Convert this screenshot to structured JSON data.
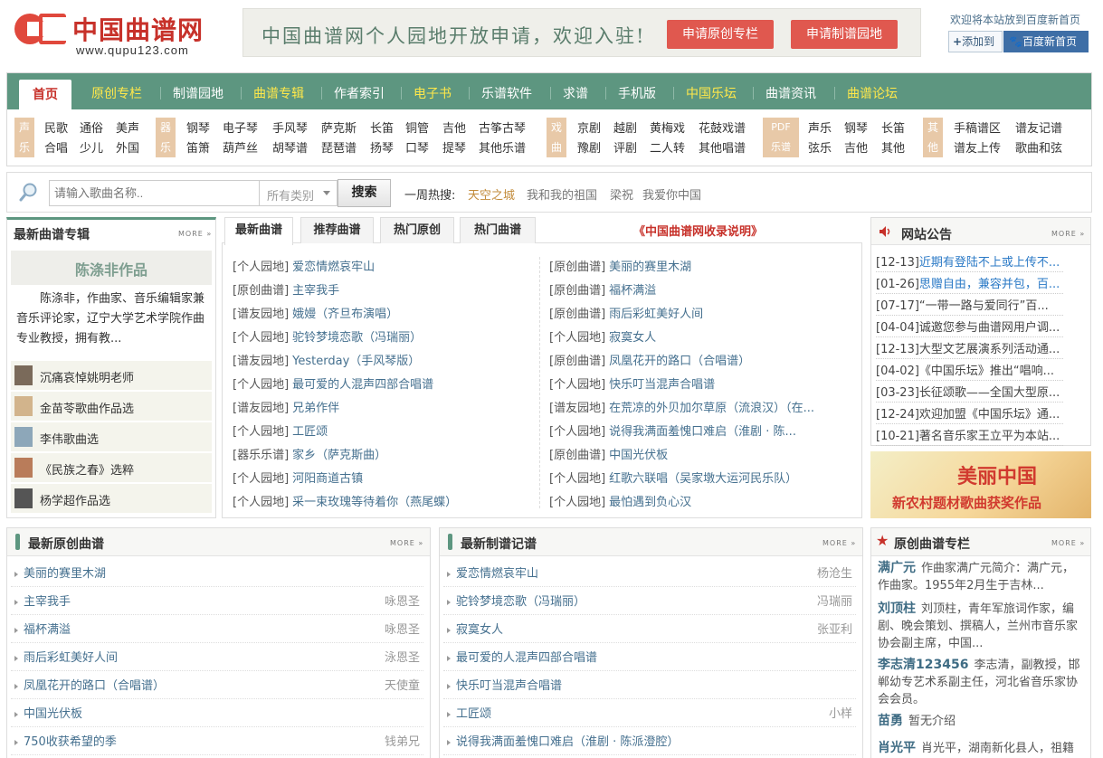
{
  "header": {
    "logo_text": "中国曲谱网",
    "logo_sub": "www.qupu123.com",
    "banner_text": "中国曲谱网个人园地开放申请，欢迎入驻!",
    "apply_original": "申请原创专栏",
    "apply_garden": "申请制谱园地",
    "welcome": "欢迎将本站放到百度新首页",
    "add_to": "添加到",
    "baidu_home": "百度新首页"
  },
  "nav": {
    "items": [
      {
        "label": "首页",
        "highlight": false
      },
      {
        "label": "原创专栏",
        "highlight": true
      },
      {
        "label": "制谱园地",
        "highlight": false
      },
      {
        "label": "曲谱专辑",
        "highlight": true
      },
      {
        "label": "作者索引",
        "highlight": false
      },
      {
        "label": "电子书",
        "highlight": true
      },
      {
        "label": "乐谱软件",
        "highlight": false
      },
      {
        "label": "求谱",
        "highlight": false
      },
      {
        "label": "手机版",
        "highlight": false
      },
      {
        "label": "中国乐坛",
        "highlight": true
      },
      {
        "label": "曲谱资讯",
        "highlight": false
      },
      {
        "label": "曲谱论坛",
        "highlight": true
      }
    ],
    "categories": [
      {
        "badge": [
          "声",
          "乐"
        ],
        "links": [
          "民歌",
          "通俗",
          "美声",
          "合唱",
          "少儿",
          "外国"
        ]
      },
      {
        "badge": [
          "器",
          "乐"
        ],
        "links": [
          "钢琴",
          "电子琴",
          "手风琴",
          "萨克斯",
          "长笛",
          "铜管",
          "吉他",
          "古筝古琴",
          "笛箫",
          "葫芦丝",
          "胡琴谱",
          "琵琶谱",
          "扬琴",
          "口琴",
          "提琴",
          "其他乐谱"
        ]
      },
      {
        "badge": [
          "戏",
          "曲"
        ],
        "links": [
          "京剧",
          "越剧",
          "黄梅戏",
          "花鼓戏谱",
          "豫剧",
          "评剧",
          "二人转",
          "其他唱谱"
        ]
      },
      {
        "badge": [
          "PDF",
          "乐谱"
        ],
        "links": [
          "声乐",
          "钢琴",
          "长笛",
          "弦乐",
          "吉他",
          "其他"
        ]
      },
      {
        "badge": [
          "其",
          "他"
        ],
        "links": [
          "手稿谱区",
          "谱友记谱",
          "谱友上传",
          "歌曲和弦"
        ]
      }
    ]
  },
  "search": {
    "placeholder": "请输入歌曲名称..",
    "category": "所有类别",
    "button": "搜索",
    "hot_label": "一周热搜:",
    "hot": [
      "天空之城",
      "我和我的祖国",
      "梁祝",
      "我爱你中国"
    ]
  },
  "albums": {
    "title": "最新曲谱专辑",
    "more": "MORE »",
    "featured_title": "陈涤非作品",
    "featured_desc": "陈涤非，作曲家、音乐编辑家兼音乐评论家，辽宁大学艺术学院作曲专业教授，拥有教...",
    "items": [
      "沉痛哀悼姚明老师",
      "金苗苓歌曲作品选",
      "李伟歌曲选",
      "《民族之春》选粹",
      "杨学超作品选"
    ]
  },
  "tabs": {
    "items": [
      "最新曲谱",
      "推荐曲谱",
      "热门原创",
      "热门曲谱"
    ],
    "notice_link": "《中国曲谱网收录说明》",
    "left": [
      {
        "tag": "[个人园地]",
        "title": "爱恋情燃哀牢山"
      },
      {
        "tag": "[原创曲谱]",
        "title": "主宰我手"
      },
      {
        "tag": "[谱友园地]",
        "title": "娥嫚（齐旦布演唱）"
      },
      {
        "tag": "[个人园地]",
        "title": "驼铃梦境恋歌（冯瑞丽）"
      },
      {
        "tag": "[谱友园地]",
        "title": "Yesterday（手风琴版）"
      },
      {
        "tag": "[个人园地]",
        "title": "最可爱的人混声四部合唱谱"
      },
      {
        "tag": "[谱友园地]",
        "title": "兄弟作伴"
      },
      {
        "tag": "[个人园地]",
        "title": "工匠颂"
      },
      {
        "tag": "[器乐乐谱]",
        "title": "家乡（萨克斯曲）"
      },
      {
        "tag": "[个人园地]",
        "title": "河阳商道古镇"
      },
      {
        "tag": "[个人园地]",
        "title": "采一束玫瑰等待着你（燕尾蝶）"
      }
    ],
    "right": [
      {
        "tag": "[原创曲谱]",
        "title": "美丽的赛里木湖"
      },
      {
        "tag": "[原创曲谱]",
        "title": "福杯满溢"
      },
      {
        "tag": "[原创曲谱]",
        "title": "雨后彩虹美好人间"
      },
      {
        "tag": "[个人园地]",
        "title": "寂寞女人"
      },
      {
        "tag": "[原创曲谱]",
        "title": "凤凰花开的路口（合唱谱）"
      },
      {
        "tag": "[个人园地]",
        "title": "快乐叮当混声合唱谱"
      },
      {
        "tag": "[谱友园地]",
        "title": "在荒凉的外贝加尔草原（流浪汉）（在..."
      },
      {
        "tag": "[个人园地]",
        "title": "说得我满面羞愧口难启（淮剧 · 陈..."
      },
      {
        "tag": "[原创曲谱]",
        "title": "中国光伏板"
      },
      {
        "tag": "[个人园地]",
        "title": "红歌六联唱（吴家墩大运河民乐队）"
      },
      {
        "tag": "[个人园地]",
        "title": "最怕遇到负心汉"
      }
    ]
  },
  "notices": {
    "title": "网站公告",
    "more": "MORE »",
    "items": [
      {
        "date": "[12-13]",
        "text": "近期有登陆不上或上传不...",
        "link": true
      },
      {
        "date": "[01-26]",
        "text": "思赠自由，兼容并包，百...",
        "link": true
      },
      {
        "date": "[07-17]",
        "text": "“一带一路与爱同行”百...",
        "link": false
      },
      {
        "date": "[04-04]",
        "text": "诚邀您参与曲谱网用户调...",
        "link": false
      },
      {
        "date": "[12-13]",
        "text": "大型文艺展演系列活动通...",
        "link": false
      },
      {
        "date": "[04-02]",
        "text": "《中国乐坛》推出“唱响...",
        "link": false
      },
      {
        "date": "[03-23]",
        "text": "长征颂歌——全国大型原...",
        "link": false
      },
      {
        "date": "[12-24]",
        "text": "欢迎加盟《中国乐坛》通...",
        "link": false
      },
      {
        "date": "[10-21]",
        "text": "著名音乐家王立平为本站...",
        "link": false
      }
    ],
    "ad_title": "美丽中国",
    "ad_sub": "新农村题材歌曲获奖作品"
  },
  "original": {
    "title": "最新原创曲谱",
    "more": "MORE »",
    "rows": [
      {
        "title": "美丽的赛里木湖",
        "author": ""
      },
      {
        "title": "主宰我手",
        "author": "咏恩圣"
      },
      {
        "title": "福杯满溢",
        "author": "咏恩圣"
      },
      {
        "title": "雨后彩虹美好人间",
        "author": "泳恩圣"
      },
      {
        "title": "凤凰花开的路口（合唱谱）",
        "author": "天使童"
      },
      {
        "title": "中国光伏板",
        "author": ""
      },
      {
        "title": "750收获希望的季",
        "author": "钱弟兄"
      }
    ]
  },
  "scored": {
    "title": "最新制谱记谱",
    "more": "MORE »",
    "rows": [
      {
        "title": "爱恋情燃哀牢山",
        "author": "杨沧生"
      },
      {
        "title": "驼铃梦境恋歌（冯瑞丽）",
        "author": "冯瑞丽"
      },
      {
        "title": "寂寞女人",
        "author": "张亚利"
      },
      {
        "title": "最可爱的人混声四部合唱谱",
        "author": ""
      },
      {
        "title": "快乐叮当混声合唱谱",
        "author": ""
      },
      {
        "title": "工匠颂",
        "author": "小样"
      },
      {
        "title": "说得我满面羞愧口难启（淮剧 · 陈派澄腔）",
        "author": ""
      }
    ]
  },
  "columns": {
    "title": "原创曲谱专栏",
    "more": "MORE »",
    "items": [
      {
        "name": "满广元",
        "desc": "作曲家满广元简介：满广元，作曲家。1955年2月生于吉林..."
      },
      {
        "name": "刘顶柱",
        "desc": "刘顶柱，青年军旅词作家，编剧、晚会策划、撰稿人，兰州市音乐家协会副主席，中国..."
      },
      {
        "name": "李志清123456",
        "desc": "李志清，副教授，邯郸幼专艺术系副主任，河北省音乐家协会会员。"
      },
      {
        "name": "苗勇",
        "desc": "暂无介绍"
      },
      {
        "name": "肖光平",
        "desc": "肖光平，湖南新化县人，祖籍湖"
      }
    ]
  },
  "colors": {
    "nav_green": "#5d9680",
    "accent_red": "#c7312a",
    "link_blue": "#45708f"
  }
}
